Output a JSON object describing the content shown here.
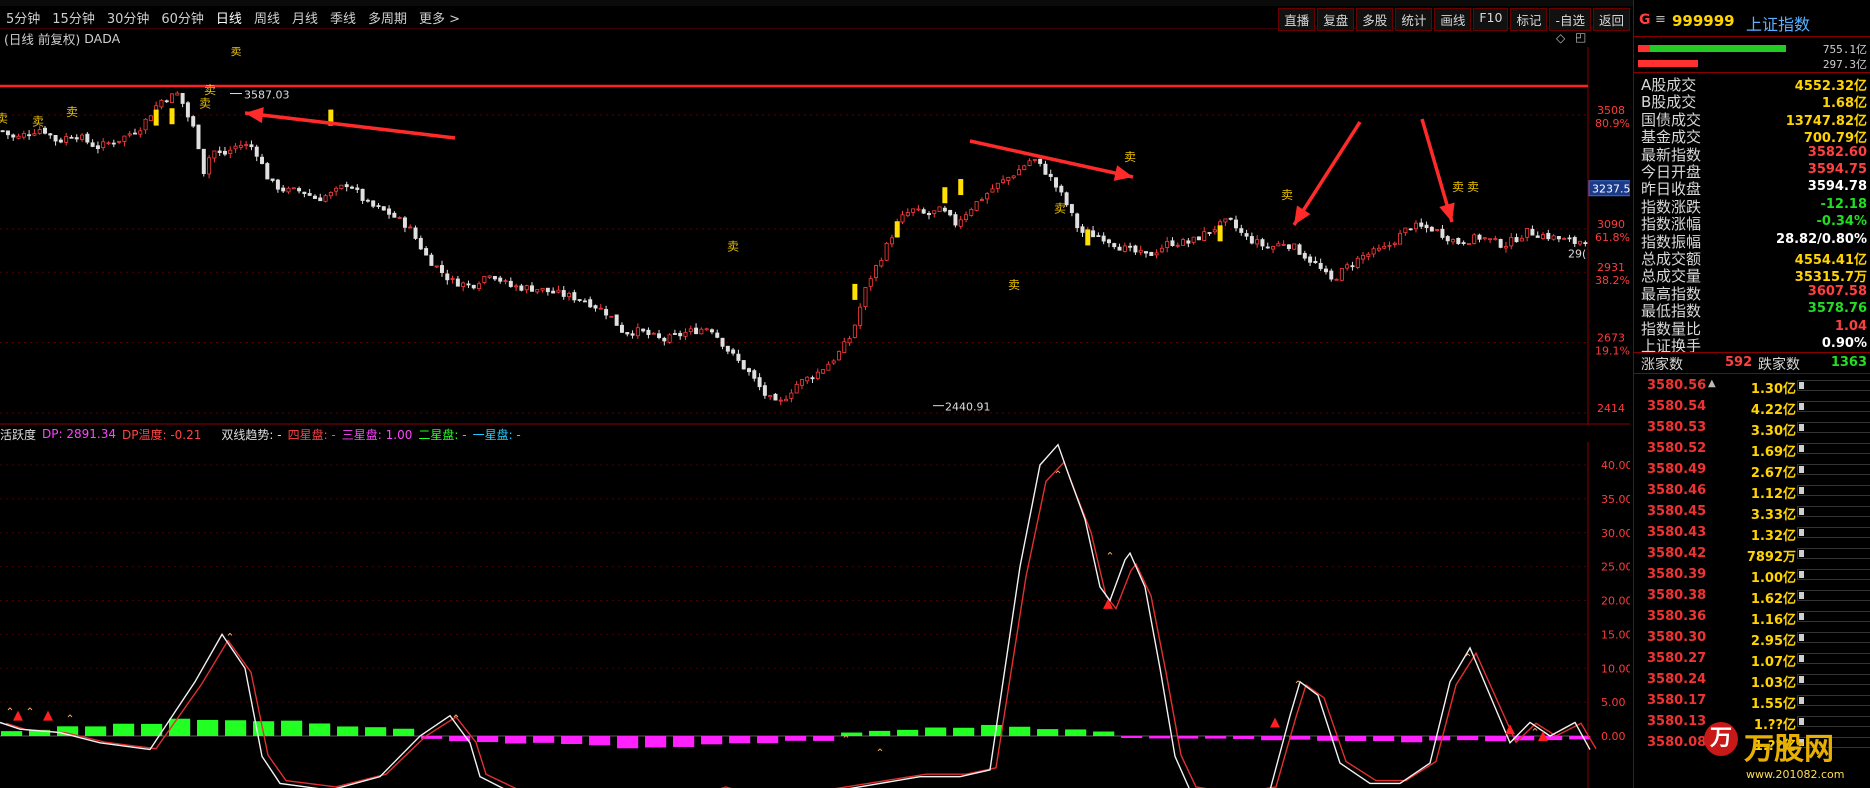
{
  "toolbar": {
    "periods": [
      "5分钟",
      "15分钟",
      "30分钟",
      "60分钟",
      "日线",
      "周线",
      "月线",
      "季线",
      "多周期",
      "更多 >"
    ],
    "active_period": "日线",
    "buttons": [
      "直播",
      "复盘",
      "多股",
      "统计",
      "画线",
      "F10",
      "标记",
      "-自选",
      "返回"
    ]
  },
  "subhead": {
    "mode": "(日线 前复权)",
    "indicator": "DADA"
  },
  "main_chart": {
    "axis_labels": [
      {
        "price": "3508",
        "pct": "80.9%"
      },
      {
        "price": "3090",
        "pct": "61.8%"
      },
      {
        "price": "2931",
        "pct": "38.2%"
      },
      {
        "price": "2673",
        "pct": "19.1%"
      },
      {
        "price": "2414",
        "pct": ""
      }
    ],
    "current_price_tag": "3237.5",
    "right_edge_fragment": "29(",
    "high_label": "3587.03",
    "low_label": "2440.91",
    "sell_label": "卖",
    "sell_marker_count": 12,
    "up_color": "#ff3b3b",
    "down_color": "#e0e0e0",
    "signal_color": "#ffe000",
    "highline_color": "#ff2020",
    "arrow_color": "#ff2a2a"
  },
  "oscillator": {
    "name": "活跃度",
    "dp_label": "DP: 2891.34",
    "dp_temp_label": "DP温度: -0.21",
    "trend_label": "双线趋势: -",
    "s4_label": "四星盘: -",
    "s3_label": "三星盘: 1.00",
    "s2_label": "二星盘: -",
    "s1_label": "一星盘: -",
    "axis": [
      "40.00",
      "35.00",
      "30.00",
      "25.00",
      "20.00",
      "15.00",
      "10.00",
      "5.00",
      "0.00"
    ],
    "ylim": [
      -7,
      44
    ],
    "colors": {
      "white_line": "#f2f2f2",
      "red_line": "#e03030",
      "green_bar": "#22ff22",
      "magenta_bar": "#ff22ff",
      "red_bar": "#dd2222"
    }
  },
  "quote": {
    "g_label": "G",
    "menu_glyph": "≡",
    "code": "999999",
    "name": "上证指数",
    "bar1_value": "755.1亿",
    "bar2_value": "297.3亿",
    "rows": [
      {
        "k": "A股成交",
        "v": "4552.32亿",
        "c": "#ffd400"
      },
      {
        "k": "B股成交",
        "v": "1.68亿",
        "c": "#ffd400"
      },
      {
        "k": "国债成交",
        "v": "13747.82亿",
        "c": "#ffd400"
      },
      {
        "k": "基金成交",
        "v": "700.79亿",
        "c": "#ffd400"
      },
      {
        "k": "最新指数",
        "v": "3582.60",
        "c": "#ff4040"
      },
      {
        "k": "今日开盘",
        "v": "3594.75",
        "c": "#ff4040"
      },
      {
        "k": "昨日收盘",
        "v": "3594.78",
        "c": "#ffffff"
      },
      {
        "k": "指数涨跌",
        "v": "-12.18",
        "c": "#22dd22"
      },
      {
        "k": "指数涨幅",
        "v": "-0.34%",
        "c": "#22dd22"
      },
      {
        "k": "指数振幅",
        "v": "28.82/0.80%",
        "c": "#ffffff"
      },
      {
        "k": "总成交额",
        "v": "4554.41亿",
        "c": "#ffd400"
      },
      {
        "k": "总成交量",
        "v": "35315.7万",
        "c": "#ffd400"
      },
      {
        "k": "最高指数",
        "v": "3607.58",
        "c": "#ff4040"
      },
      {
        "k": "最低指数",
        "v": "3578.76",
        "c": "#22dd22"
      },
      {
        "k": "指数量比",
        "v": "1.04",
        "c": "#ff4040"
      },
      {
        "k": "上证换手",
        "v": "0.90%",
        "c": "#ffffff"
      }
    ],
    "up_label": "涨家数",
    "up_count": "592",
    "down_label": "跌家数",
    "down_count": "1363",
    "ticks": [
      {
        "p": "3580.56",
        "v": "1.30亿",
        "a": "▲"
      },
      {
        "p": "3580.54",
        "v": "4.22亿"
      },
      {
        "p": "3580.53",
        "v": "3.30亿"
      },
      {
        "p": "3580.52",
        "v": "1.69亿"
      },
      {
        "p": "3580.49",
        "v": "2.67亿"
      },
      {
        "p": "3580.46",
        "v": "1.12亿"
      },
      {
        "p": "3580.45",
        "v": "3.33亿"
      },
      {
        "p": "3580.43",
        "v": "1.32亿"
      },
      {
        "p": "3580.42",
        "v": "7892万"
      },
      {
        "p": "3580.39",
        "v": "1.00亿"
      },
      {
        "p": "3580.38",
        "v": "1.62亿"
      },
      {
        "p": "3580.36",
        "v": "1.16亿"
      },
      {
        "p": "3580.30",
        "v": "2.95亿"
      },
      {
        "p": "3580.27",
        "v": "1.07亿"
      },
      {
        "p": "3580.24",
        "v": "1.03亿"
      },
      {
        "p": "3580.17",
        "v": "1.55亿"
      },
      {
        "p": "3580.13",
        "v": "1.??亿"
      },
      {
        "p": "3580.08",
        "v": "1.??亿"
      }
    ]
  },
  "watermark": {
    "text": "万股网",
    "url": "www.201082.com"
  }
}
